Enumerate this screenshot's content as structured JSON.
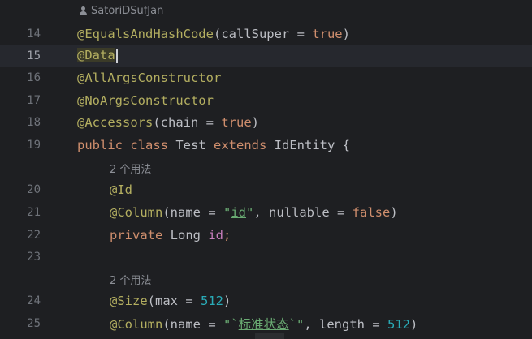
{
  "editor": {
    "author": "SatoriDSufJan",
    "usage_hint_1": "2 个用法",
    "usage_hint_2": "2 个用法",
    "lines": {
      "l14": {
        "num": "14",
        "ann": "@EqualsAndHashCode",
        "p1": "(callSuper = ",
        "kw": "true",
        "p2": ")"
      },
      "l15": {
        "num": "15",
        "ann": "@Data"
      },
      "l16": {
        "num": "16",
        "ann": "@AllArgsConstructor"
      },
      "l17": {
        "num": "17",
        "ann": "@NoArgsConstructor"
      },
      "l18": {
        "num": "18",
        "ann": "@Accessors",
        "p1": "(chain = ",
        "kw": "true",
        "p2": ")"
      },
      "l19": {
        "num": "19",
        "kw1": "public",
        "kw2": "class",
        "name": " Test ",
        "kw3": "extends",
        "rest": " IdEntity {"
      },
      "l20": {
        "num": "20",
        "ann": "@Id"
      },
      "l21": {
        "num": "21",
        "ann": "@Column",
        "p1": "(name = ",
        "q1": "\"",
        "s": "id",
        "q2": "\"",
        "p2": ", nullable = ",
        "kw": "false",
        "p3": ")"
      },
      "l22": {
        "num": "22",
        "kw": "private",
        "type": " Long ",
        "field": "id",
        "semi": ";"
      },
      "l23": {
        "num": "23"
      },
      "l24": {
        "num": "24",
        "ann": "@Size",
        "p1": "(max = ",
        "n": "512",
        "p2": ")"
      },
      "l25": {
        "num": "25",
        "ann": "@Column",
        "p1": "(name = ",
        "q1": "\"`",
        "s": "标准状态",
        "q2": "`\"",
        "p2": ", length = ",
        "n": "512",
        "p3": ")"
      }
    }
  },
  "colors": {
    "background": "#1e1f22",
    "annotation": "#b3ae60",
    "keyword": "#cf8e6d",
    "string": "#6aab73",
    "number": "#2aacb8",
    "field": "#c77dbb"
  }
}
